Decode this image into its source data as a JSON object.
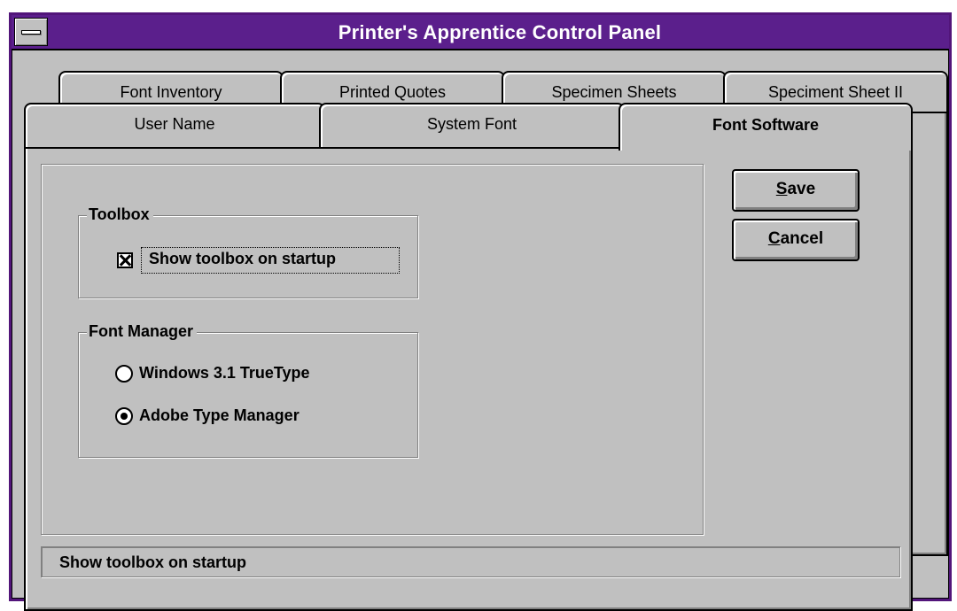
{
  "window": {
    "title": "Printer's Apprentice Control Panel"
  },
  "tabs": {
    "back_row": [
      {
        "label": "Font Inventory"
      },
      {
        "label": "Printed Quotes"
      },
      {
        "label": "Specimen Sheets"
      },
      {
        "label": "Speciment Sheet II"
      }
    ],
    "front_row": [
      {
        "label": "User Name"
      },
      {
        "label": "System Font"
      },
      {
        "label": "Font Software",
        "active": true
      }
    ]
  },
  "toolbox": {
    "legend": "Toolbox",
    "checkbox_label": "Show toolbox on startup",
    "checked": true
  },
  "font_manager": {
    "legend": "Font Manager",
    "options": [
      {
        "label": "Windows 3.1 TrueType",
        "selected": false
      },
      {
        "label": "Adobe Type Manager",
        "selected": true
      }
    ]
  },
  "buttons": {
    "save": {
      "label_first": "S",
      "label_rest": "ave"
    },
    "cancel": {
      "label_first": "C",
      "label_rest": "ancel"
    }
  },
  "status_bar": {
    "text": "Show toolbox on startup"
  },
  "icons": {
    "system_menu": "system-menu-bar-icon"
  }
}
